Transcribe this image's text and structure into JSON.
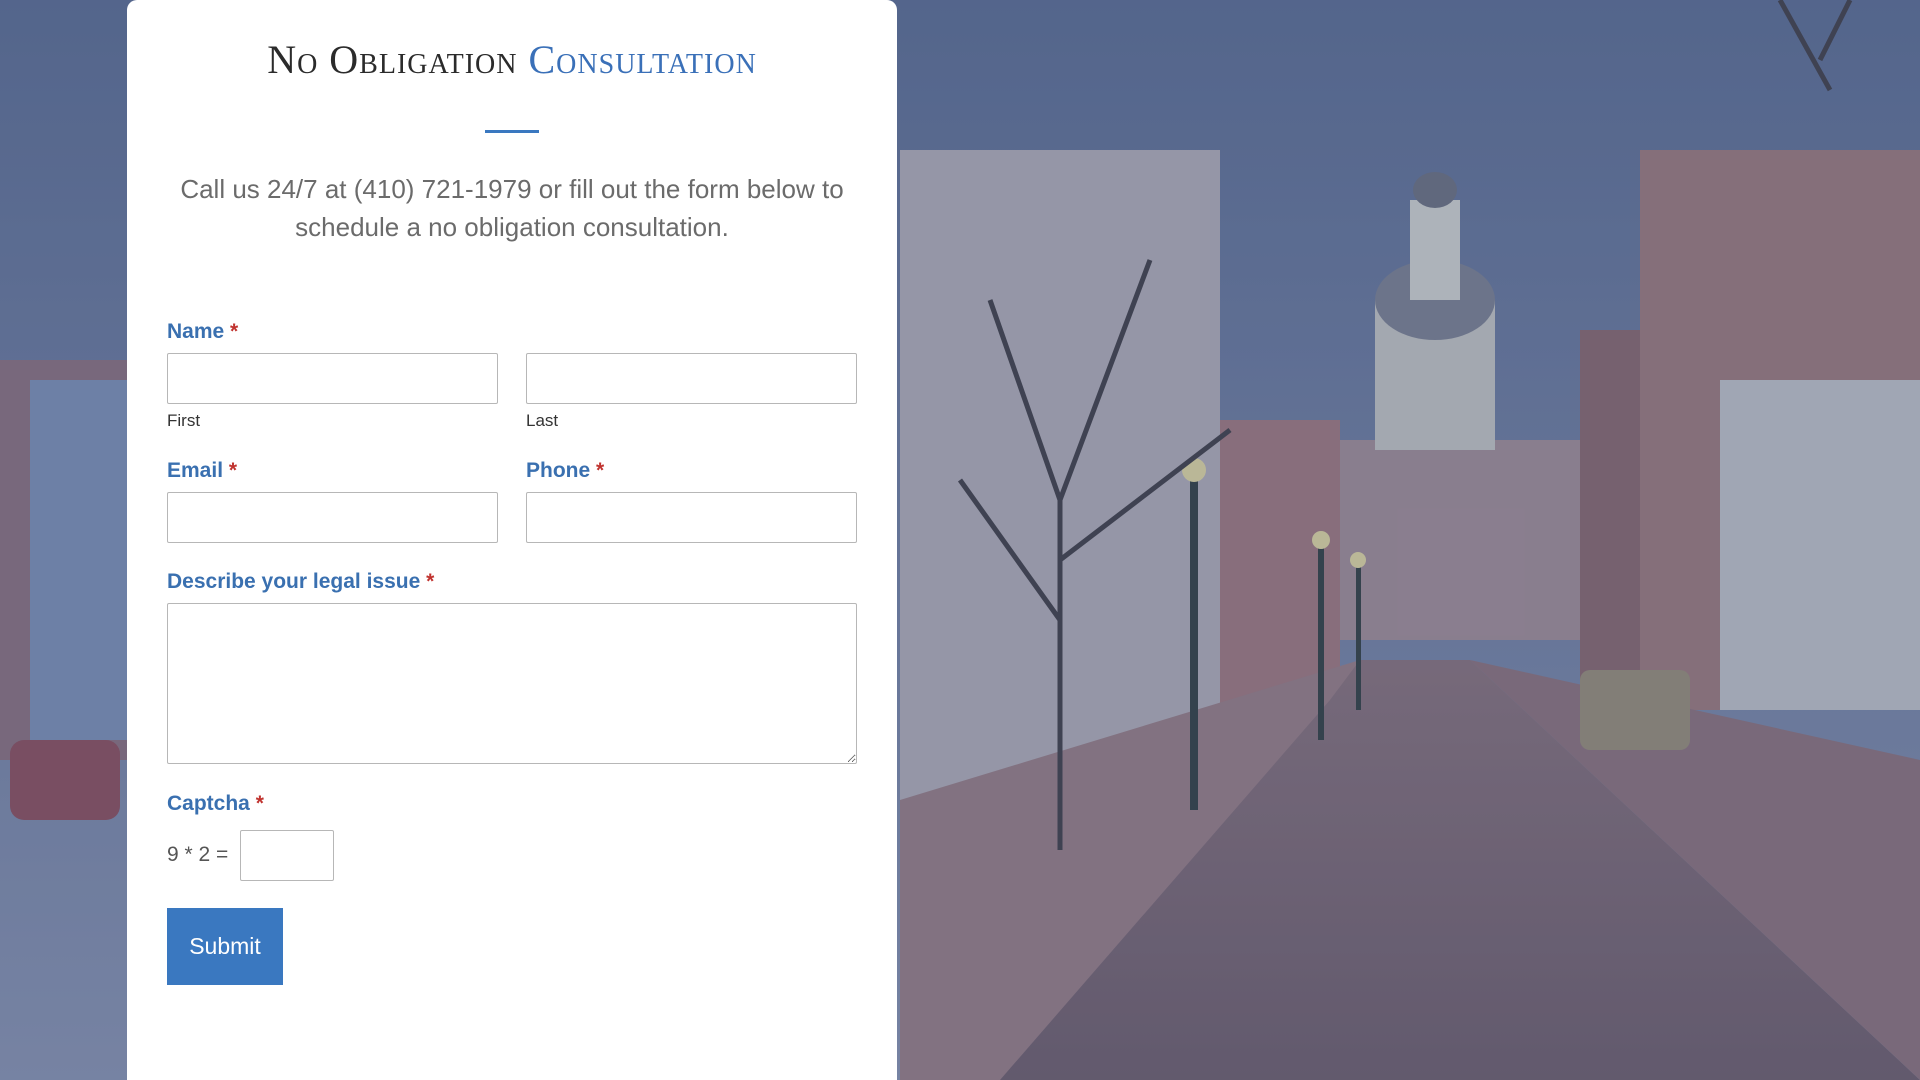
{
  "form": {
    "title_part1": "No Obligation",
    "title_part2": "Consultation",
    "intro": "Call us 24/7 at (410) 721-1979 or fill out the form below to schedule a no obligation consultation.",
    "required_marker": "*",
    "name_label": "Name",
    "first_sublabel": "First",
    "last_sublabel": "Last",
    "email_label": "Email",
    "phone_label": "Phone",
    "issue_label": "Describe your legal issue",
    "captcha_label": "Captcha",
    "captcha_question": "9 * 2 =",
    "submit_label": "Submit",
    "first_value": "",
    "last_value": "",
    "email_value": "",
    "phone_value": "",
    "issue_value": "",
    "captcha_value": ""
  },
  "colors": {
    "accent": "#3a70b8",
    "button": "#3a78c0",
    "required": "#c0322e",
    "overlay": "#5d6a8a"
  },
  "background": {
    "icon": "street-scene-image"
  }
}
